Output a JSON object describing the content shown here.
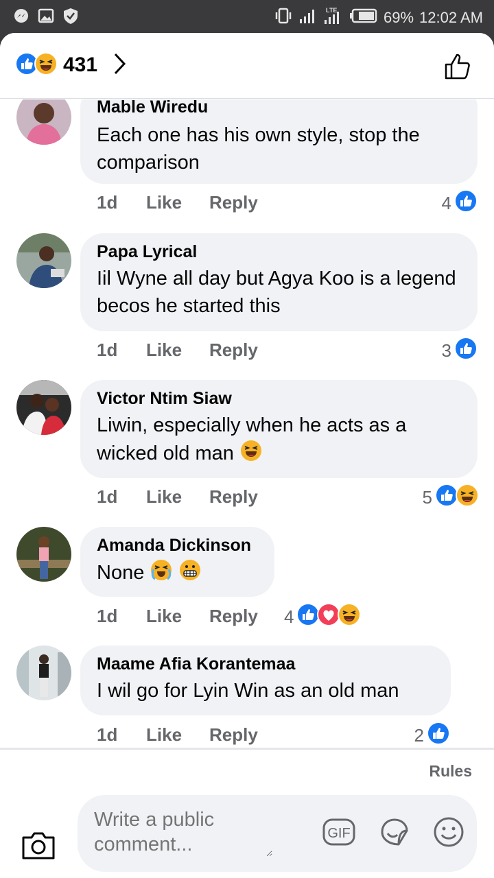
{
  "status_bar": {
    "battery": "69%",
    "time": "12:02 AM",
    "network": "LTE",
    "icons": [
      "messenger-icon",
      "gallery-icon",
      "shield-icon",
      "vibrate-icon",
      "signal-icon",
      "lte-signal-icon",
      "battery-icon"
    ]
  },
  "header": {
    "reaction_count": "431",
    "reaction_icons": [
      "like-reaction-icon",
      "haha-reaction-icon"
    ]
  },
  "comments": [
    {
      "author": "Mable Wiredu",
      "text": "Each one has his own style, stop the comparison",
      "time": "1d",
      "like": "Like",
      "reply": "Reply",
      "reaction_count": "4",
      "reactions": [
        "like"
      ]
    },
    {
      "author": "Papa Lyrical",
      "text": "Iil Wyne all day but Agya Koo is a legend becos he started this",
      "time": "1d",
      "like": "Like",
      "reply": "Reply",
      "reaction_count": "3",
      "reactions": [
        "like"
      ]
    },
    {
      "author": "Victor Ntim Siaw",
      "text": "Liwin, especially when he acts as a wicked old man",
      "time": "1d",
      "like": "Like",
      "reply": "Reply",
      "reaction_count": "5",
      "reactions": [
        "like",
        "haha"
      ]
    },
    {
      "author": "Amanda Dickinson",
      "text": "None",
      "time": "1d",
      "like": "Like",
      "reply": "Reply",
      "reaction_count": "4",
      "reactions": [
        "like",
        "love",
        "haha"
      ]
    },
    {
      "author": "Maame Afia Korantemaa",
      "text": "I wil go for Lyin Win as an old man",
      "time": "1d",
      "like": "Like",
      "reply": "Reply",
      "reaction_count": "2",
      "reactions": [
        "like"
      ]
    }
  ],
  "footer": {
    "rules": "Rules",
    "placeholder": "Write a public comment...",
    "gif_label": "GIF"
  },
  "colors": {
    "facebook_blue": "#1877f2",
    "love_red": "#f33e58",
    "haha_yellow": "#f7b125",
    "bubble_grey": "#f0f2f5",
    "secondary_text": "#65676b"
  }
}
